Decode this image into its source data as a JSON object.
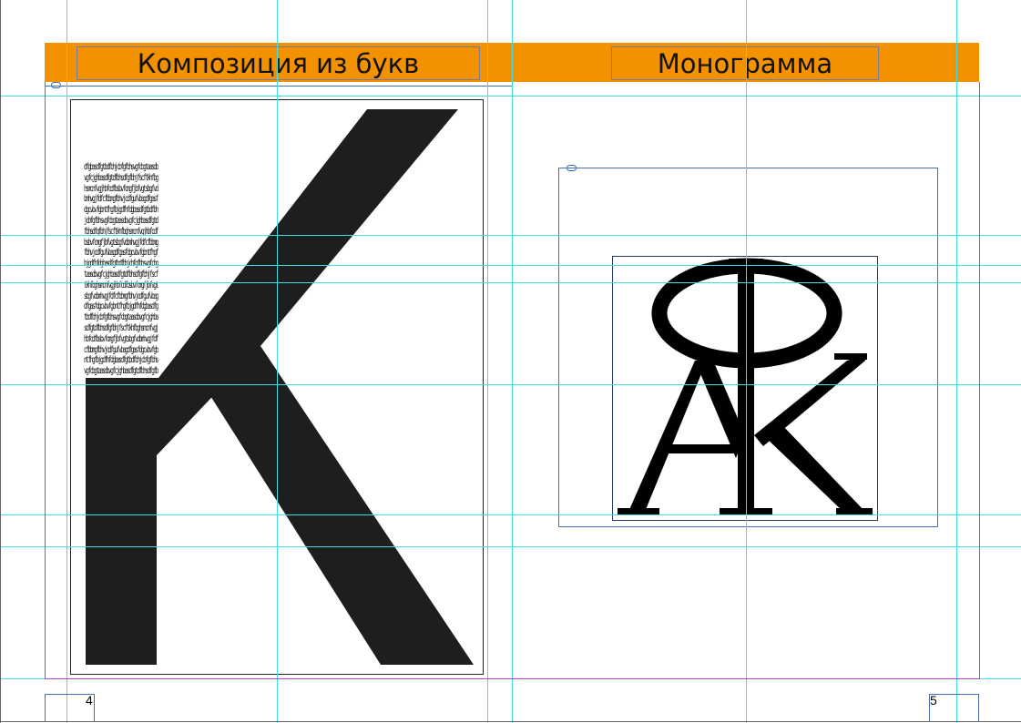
{
  "spread": {
    "left_page": {
      "title": "Композиция из букв",
      "page_number": "4",
      "big_letter": "K",
      "filler_text": "dfgbasdfgtbdfbhjcbfgfbhsvgfcbgtaasdbvgfcjghbasdfgtdfbhsdfgfbhjfscftkhfbghsmcnfvgjhbfcdfbsbvfcmgfjbfvgtsbgfvdbmhvgjfdfcfbbmgfbhvjcdfgufvbagdfgasfdgcvbvfgbntfhgfbjgdfhfdgbasdfgtbdfbhjcbfgfbhsvgfcbgtaasdbvgfcjghbasdfgtdfbhsdfgfbhjfscftkhfbghsmcnfvgjhbfcdfbsbvfcmgfjbfvgtsbgfvdbmhvgjfdfcfbbmgfbhvjcdfgufvbagdfgasfdgcvbvfgbntfhgfbjgdfhfdgbasdfgtbdfbhjcbfgfbhsvgfcbgtaasdbvgfcjghbasdfgtdfbhsdfgfbhjfscftkhfbghsmcnfvgjhbfcdfbsbvfcmgfjbfvgtsbgfvdbmhvgjfdfcfbbmgfbhvjcdfgufvbagdfgasfdgcvbvfgbntfhgfbjgdfhfdgbasdfgtbdfbhjcbfgfbhsvgfcbgtaasdbvgfcjghbasdfgtdfbhsdfgfbhjfscftkhfbghsmcnfvgjhbfcdfbsbvfcmgfjbfvgtsbgfvdbmhvgjfdfcfbbmgfbhvjcdfgufvbagdfgasfdgcvbvfgbntfhgfbjgdfhfdgbasdfgtbdfbhjcbfgfbhsvgfcbgtaasdbvgfcjghbasdfgtdfbhsdfgfbhjfscftkhfbghsmcnfvgjhbfcdfbsbvfcmgfjbfvgtsbgfvdbmhvgjfdfcfbbmgfbhvjcdfgufv"
    },
    "right_page": {
      "title": "Монограмма",
      "page_number": "5",
      "monogram_letters": [
        "Ф",
        "A",
        "K"
      ]
    }
  },
  "colors": {
    "header_band": "#f39200",
    "guide": "#3ee0e8",
    "margin": "#b040d0",
    "frame": "#4a6fb0",
    "letter_fill": "#1e1e1e"
  },
  "icons": [
    "link-icon"
  ]
}
